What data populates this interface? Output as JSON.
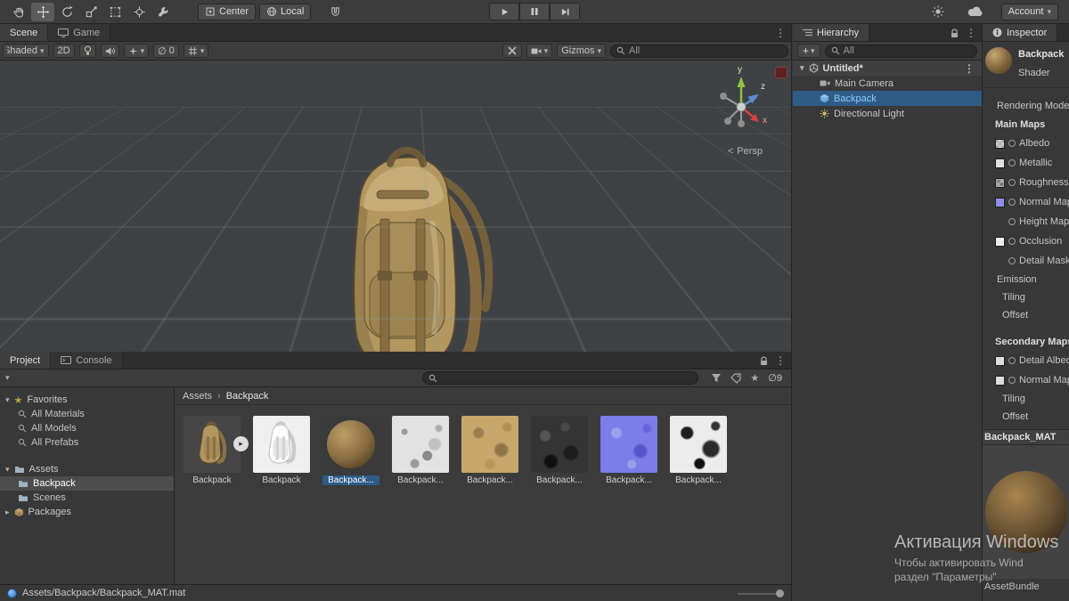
{
  "colors": {
    "selection_blue": "#2D5C87",
    "prefab_text_blue": "#8CCBFF",
    "scene_bg": "#3F4245",
    "panel_bg": "#383838",
    "normal_map_purple": "#8F8FE8",
    "material_brown": "#B3975F"
  },
  "icons": {
    "kebab": "⋮",
    "caret_down": "▾",
    "caret_right": "▸",
    "star": "★",
    "empty_set": "∅",
    "breadcrumb_sep": "›",
    "expand_badge": "▸",
    "persp_toggle": "<",
    "plus": "+"
  },
  "top_toolbar": {
    "center_label": "Center",
    "local_label": "Local",
    "account_label": "Account"
  },
  "scene_panel": {
    "tabs": [
      {
        "label": "Scene"
      },
      {
        "label": "Game"
      }
    ],
    "toolbar": {
      "shading_mode": "Shaded",
      "mode_2d": "2D",
      "hidden_count": "0",
      "gizmos_label": "Gizmos",
      "search_value": "All"
    },
    "gizmo": {
      "axis_y": "y",
      "axis_z": "z",
      "axis_x": "x",
      "projection": "Persp"
    }
  },
  "hierarchy": {
    "tab_label": "Hierarchy",
    "add_label": "+",
    "search_value": "All",
    "scene_name": "Untitled*",
    "items": [
      {
        "label": "Main Camera"
      },
      {
        "label": "Backpack"
      },
      {
        "label": "Directional Light"
      }
    ]
  },
  "inspector": {
    "tab_label": "Inspector",
    "material_name": "Backpack",
    "shader_label": "Shader",
    "rendering_mode_label": "Rendering Mode",
    "main_maps_label": "Main Maps",
    "main_maps": [
      {
        "label": "Albedo"
      },
      {
        "label": "Metallic"
      },
      {
        "label": "Roughness"
      },
      {
        "label": "Normal Map"
      },
      {
        "label": "Height Map"
      },
      {
        "label": "Occlusion"
      },
      {
        "label": "Detail Mask"
      }
    ],
    "emission_label": "Emission",
    "tiling_label": "Tiling",
    "offset_label": "Offset",
    "secondary_maps_label": "Secondary Maps",
    "secondary_maps": [
      {
        "label": "Detail Albedo"
      },
      {
        "label": "Normal Map"
      }
    ],
    "tiling2_label": "Tiling",
    "offset2_label": "Offset",
    "preview_title": "Backpack_MAT",
    "assetbundle_label": "AssetBundle"
  },
  "project": {
    "tabs": [
      {
        "label": "Project"
      },
      {
        "label": "Console"
      }
    ],
    "sidebar": {
      "favorites_label": "Favorites",
      "favorites": [
        {
          "label": "All Materials"
        },
        {
          "label": "All Models"
        },
        {
          "label": "All Prefabs"
        }
      ],
      "assets_label": "Assets",
      "folders": [
        {
          "label": "Backpack"
        },
        {
          "label": "Scenes"
        }
      ],
      "packages_label": "Packages"
    },
    "breadcrumb": {
      "root": "Assets",
      "current": "Backpack"
    },
    "search_value": "",
    "hidden_count": "9",
    "items": [
      {
        "label": "Backpack"
      },
      {
        "label": "Backpack"
      },
      {
        "label": "Backpack..."
      },
      {
        "label": "Backpack..."
      },
      {
        "label": "Backpack..."
      },
      {
        "label": "Backpack..."
      },
      {
        "label": "Backpack..."
      },
      {
        "label": "Backpack..."
      }
    ],
    "status_path": "Assets/Backpack/Backpack_MAT.mat"
  },
  "watermark": {
    "line1": "Активация Windows",
    "line2": "Чтобы активировать Wind",
    "line3": "раздел \"Параметры\""
  }
}
